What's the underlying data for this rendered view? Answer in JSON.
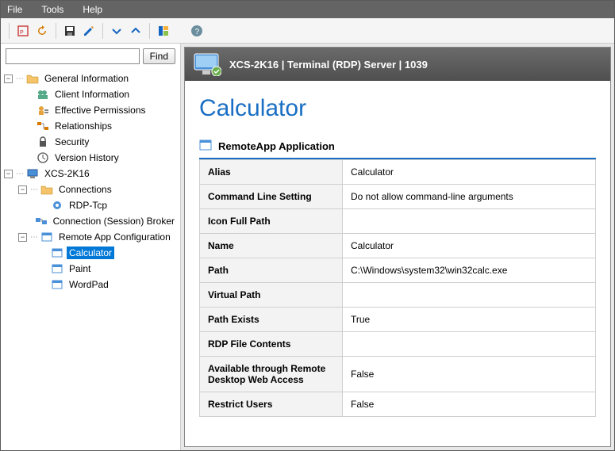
{
  "menu": {
    "file": "File",
    "tools": "Tools",
    "help": "Help"
  },
  "search": {
    "placeholder": "",
    "find_label": "Find"
  },
  "tree": {
    "root1": "General Information",
    "client_info": "Client Information",
    "eff_perm": "Effective Permissions",
    "relationships": "Relationships",
    "security": "Security",
    "version_history": "Version History",
    "server": "XCS-2K16",
    "connections": "Connections",
    "rdptcp": "RDP-Tcp",
    "session_broker": "Connection (Session) Broker",
    "remoteapp": "Remote App Configuration",
    "calculator": "Calculator",
    "paint": "Paint",
    "wordpad": "WordPad"
  },
  "header": {
    "title": "XCS-2K16 | Terminal (RDP) Server | 1039"
  },
  "page": {
    "title": "Calculator",
    "section": "RemoteApp Application"
  },
  "props": {
    "alias_k": "Alias",
    "alias_v": "Calculator",
    "cls_k": "Command Line Setting",
    "cls_v": "Do not allow command-line arguments",
    "iconpath_k": "Icon Full Path",
    "iconpath_v": "",
    "name_k": "Name",
    "name_v": "Calculator",
    "path_k": "Path",
    "path_v": "C:\\Windows\\system32\\win32calc.exe",
    "vpath_k": "Virtual Path",
    "vpath_v": "",
    "pexists_k": "Path Exists",
    "pexists_v": "True",
    "rdpfile_k": "RDP File Contents",
    "rdpfile_v": "",
    "webaccess_k": "Available through Remote Desktop Web Access",
    "webaccess_v": "False",
    "restrict_k": "Restrict Users",
    "restrict_v": "False"
  }
}
